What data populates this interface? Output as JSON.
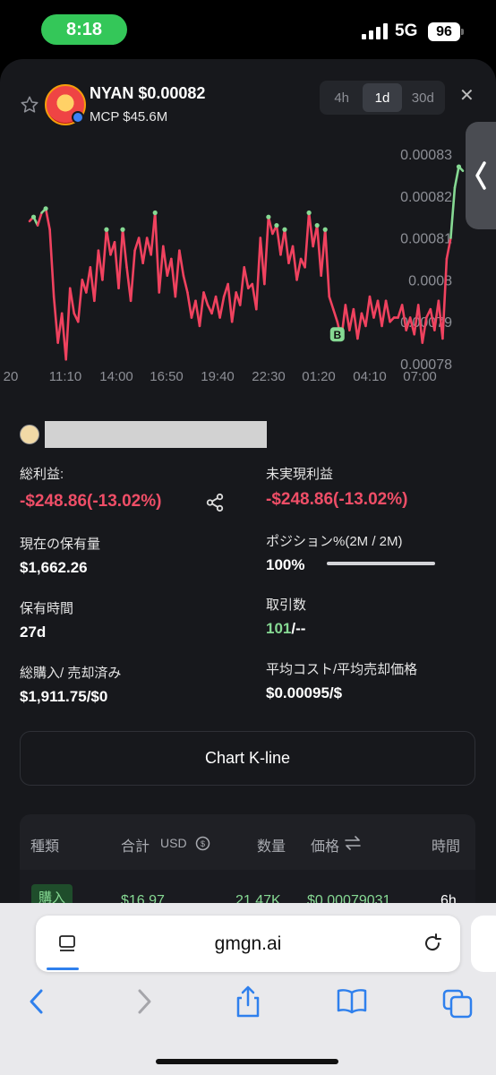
{
  "status": {
    "time": "8:18",
    "network": "5G",
    "battery": "96"
  },
  "token": {
    "name": "NYAN $0.00082",
    "mcp": "MCP $45.6M"
  },
  "timeframes": [
    {
      "label": "4h",
      "active": false
    },
    {
      "label": "1d",
      "active": true
    },
    {
      "label": "30d",
      "active": false
    }
  ],
  "chart_data": {
    "type": "line",
    "y_ticks": [
      "0.00083",
      "0.00082",
      "0.00081",
      "0.0008",
      "0.00079",
      "0.00078"
    ],
    "ylim": [
      0.00078,
      0.00083
    ],
    "x_ticks": [
      "20",
      "11:10",
      "14:00",
      "16:50",
      "19:40",
      "22:30",
      "01:20",
      "04:10",
      "07:00"
    ],
    "marker": "B",
    "series": [
      {
        "values": [
          0.000814,
          0.000815,
          0.000813,
          0.000816,
          0.000817,
          0.000812,
          0.000796,
          0.000785,
          0.000792,
          0.000781,
          0.000798,
          0.000792,
          0.00079,
          0.0008,
          0.000797,
          0.000803,
          0.000795,
          0.000807,
          0.0008,
          0.000812,
          0.000806,
          0.000809,
          0.000798,
          0.000812,
          0.000803,
          0.000795,
          0.000807,
          0.00081,
          0.000804,
          0.00081,
          0.000806,
          0.000816,
          0.000797,
          0.000808,
          0.000801,
          0.000805,
          0.000796,
          0.000807,
          0.000801,
          0.000797,
          0.000791,
          0.000795,
          0.000789,
          0.000797,
          0.000794,
          0.000792,
          0.000796,
          0.000791,
          0.000796,
          0.000799,
          0.00079,
          0.000797,
          0.000794,
          0.000803,
          0.000798,
          0.000799,
          0.000793,
          0.00081,
          0.000799,
          0.000815,
          0.000811,
          0.000813,
          0.000806,
          0.000812,
          0.000804,
          0.000808,
          0.0008,
          0.000805,
          0.000803,
          0.000816,
          0.000808,
          0.000813,
          0.000801,
          0.000812,
          0.000796,
          0.000793,
          0.00079,
          0.000786,
          0.000794,
          0.000788,
          0.000793,
          0.000786,
          0.000792,
          0.000789,
          0.000796,
          0.000791,
          0.000795,
          0.000789,
          0.000795,
          0.00079,
          0.000791,
          0.000791,
          0.000794,
          0.000788,
          0.000791,
          0.000787,
          0.000794,
          0.000785,
          0.000791,
          0.000793,
          0.000788,
          0.000795,
          0.000786,
          0.000805,
          0.00081,
          0.000822,
          0.000827,
          0.000826
        ]
      }
    ]
  },
  "user": {
    "name": ""
  },
  "stats": {
    "total_pnl_label": "総利益:",
    "total_pnl_value": "-$248.86(-13.02%)",
    "unrealized_label": "未実現利益",
    "unrealized_value": "-$248.86(-13.02%)",
    "holding_label": "現在の保有量",
    "holding_value": "$1,662.26",
    "position_label": "ポジション%(2M / 2M)",
    "position_value": "100%",
    "position_fill": 1.0,
    "hold_time_label": "保有時間",
    "hold_time_value": "27d",
    "trades_label": "取引数",
    "trades_count": "101",
    "trades_rest": "/--",
    "bought_sold_label": "総購入/ 売却済み",
    "bought_sold_value": "$1,911.75/$0",
    "avg_cost_label": "平均コスト/平均売却価格",
    "avg_cost_value": "$0.00095/$"
  },
  "kline_button": "Chart K-line",
  "table": {
    "headers": {
      "type": "種類",
      "total": "合計",
      "usd": "USD",
      "qty": "数量",
      "price": "価格",
      "time": "時間"
    },
    "row": {
      "badge": "購入",
      "total": "$16.97",
      "qty": "21.47K",
      "price": "$0.00079031",
      "time": "6h"
    }
  },
  "browser": {
    "url": "gmgn.ai"
  },
  "colors": {
    "accent_green": "#86d993",
    "loss_red": "#ef4e67",
    "line_red": "#f0425f",
    "sheet_bg": "#17181c"
  }
}
